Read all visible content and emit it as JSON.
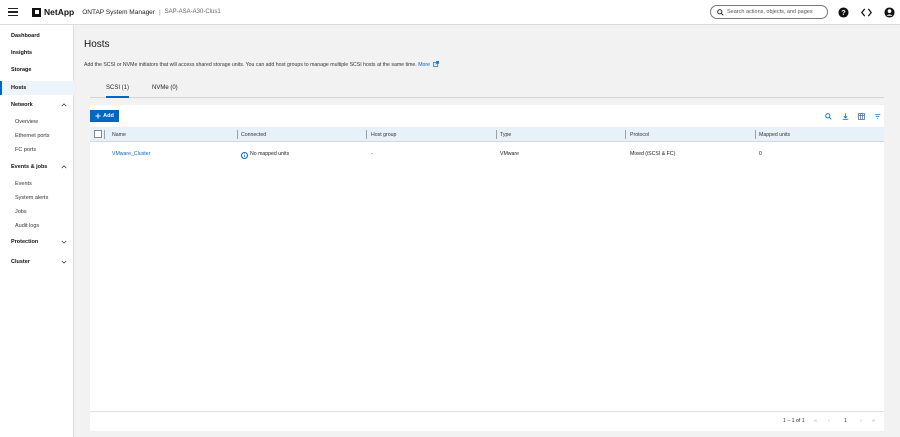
{
  "header": {
    "logo_text": "NetApp",
    "app_name": "ONTAP System Manager",
    "separator": "|",
    "cluster_name": "SAP-ASA-A30-Clus1",
    "search_placeholder": "Search actions, objects, and pages"
  },
  "sidebar": {
    "items": [
      {
        "label": "Dashboard"
      },
      {
        "label": "Insights"
      },
      {
        "label": "Storage"
      },
      {
        "label": "Hosts"
      },
      {
        "label": "Network"
      },
      {
        "label": "Overview"
      },
      {
        "label": "Ethernet ports"
      },
      {
        "label": "FC ports"
      },
      {
        "label": "Events & jobs"
      },
      {
        "label": "Events"
      },
      {
        "label": "System alerts"
      },
      {
        "label": "Jobs"
      },
      {
        "label": "Audit logs"
      },
      {
        "label": "Protection"
      },
      {
        "label": "Cluster"
      }
    ]
  },
  "main": {
    "title": "Hosts",
    "description": "Add the SCSI or NVMe initiators that will access shared storage units. You can add host groups to manage multiple SCSI hosts at the same time.",
    "more_link": "More",
    "tabs": [
      {
        "label": "SCSI (1)"
      },
      {
        "label": "NVMe (0)"
      }
    ],
    "add_label": "Add",
    "table": {
      "columns": [
        "Name",
        "Connected",
        "Host group",
        "Type",
        "Protocol",
        "Mapped units"
      ],
      "rows": [
        {
          "name": "VMware_Cluster",
          "connected": "No mapped units",
          "host_group": "-",
          "type": "VMware",
          "protocol": "Mixed (iSCSI & FC)",
          "mapped_units": "0"
        }
      ]
    },
    "pagination": {
      "range": "1 – 1 of 1",
      "page": "1"
    }
  },
  "colors": {
    "accent": "#0067c5",
    "header_row": "#e8f1fa"
  }
}
